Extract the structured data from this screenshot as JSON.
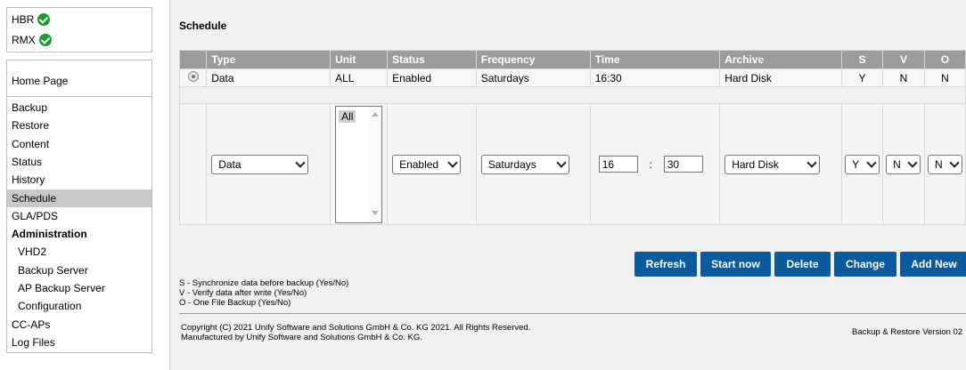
{
  "status": [
    {
      "label": "HBR",
      "state": "ok"
    },
    {
      "label": "RMX",
      "state": "ok"
    }
  ],
  "nav": {
    "home": "Home Page",
    "items": [
      {
        "label": "Backup",
        "type": "item"
      },
      {
        "label": "Restore",
        "type": "item"
      },
      {
        "label": "Content",
        "type": "item"
      },
      {
        "label": "Status",
        "type": "item"
      },
      {
        "label": "History",
        "type": "item"
      },
      {
        "label": "Schedule",
        "type": "item",
        "active": true
      },
      {
        "label": "GLA/PDS",
        "type": "item"
      },
      {
        "label": "Administration",
        "type": "header"
      },
      {
        "label": "VHD2",
        "type": "sub"
      },
      {
        "label": "Backup Server",
        "type": "sub"
      },
      {
        "label": "AP Backup Server",
        "type": "sub"
      },
      {
        "label": "Configuration",
        "type": "sub"
      },
      {
        "label": "CC-APs",
        "type": "item"
      },
      {
        "label": "Log Files",
        "type": "item"
      }
    ]
  },
  "page": {
    "title": "Schedule"
  },
  "table": {
    "headers": [
      "",
      "Type",
      "Unit",
      "Status",
      "Frequency",
      "Time",
      "Archive",
      "S",
      "V",
      "O"
    ],
    "row": {
      "type": "Data",
      "unit": "ALL",
      "status": "Enabled",
      "frequency": "Saturdays",
      "time": "16:30",
      "archive": "Hard Disk",
      "s": "Y",
      "v": "N",
      "o": "N"
    }
  },
  "edit": {
    "type": "Data",
    "unit_option": "All",
    "status": "Enabled",
    "frequency": "Saturdays",
    "hour": "16",
    "colon": ":",
    "minute": "30",
    "archive": "Hard Disk",
    "s": "Y",
    "v": "N",
    "o": "N"
  },
  "buttons": {
    "refresh": "Refresh",
    "start": "Start now",
    "delete": "Delete",
    "change": "Change",
    "add": "Add New"
  },
  "legend": [
    "S - Synchronize data before backup (Yes/No)",
    "V - Verify data after write (Yes/No)",
    "O - One File Backup (Yes/No)"
  ],
  "footer": {
    "copyright": "Copyright (C) 2021 Unify Software and Solutions GmbH & Co. KG 2021. All Rights Reserved.",
    "manufacturer": "Manufactured by Unify Software and Solutions GmbH & Co. KG.",
    "version": "Backup & Restore Version 02"
  },
  "colors": {
    "button": "#0b5a9e",
    "header": "#9b9b9b",
    "ok": "#1a9c2c",
    "active_nav": "#c8c8c8"
  }
}
